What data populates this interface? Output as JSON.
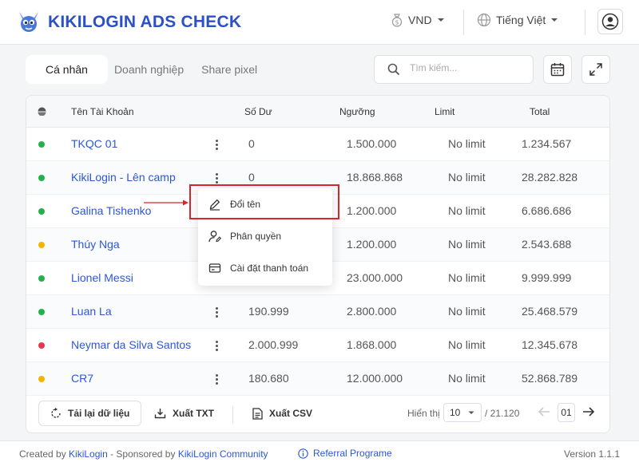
{
  "header": {
    "title": "KIKILOGIN ADS CHECK",
    "currency": "VND",
    "language": "Tiếng Việt"
  },
  "tabs": [
    {
      "label": "Cá nhân",
      "active": true
    },
    {
      "label": "Doanh nghiệp",
      "active": false
    },
    {
      "label": "Share pixel",
      "active": false
    }
  ],
  "search": {
    "placeholder": "Tìm kiếm...",
    "value": ""
  },
  "table": {
    "columns": [
      "Tên Tài Khoản",
      "Số Dư",
      "Ngưỡng",
      "Limit",
      "Total"
    ],
    "rows": [
      {
        "status": "#22b24c",
        "name": "TKQC 01",
        "balance": "0",
        "threshold": "1.500.000",
        "limit": "No limit",
        "total": "1.234.567"
      },
      {
        "status": "#22b24c",
        "name": "KikiLogin - Lên camp",
        "balance": "0",
        "threshold": "18.868.868",
        "limit": "No limit",
        "total": "28.282.828"
      },
      {
        "status": "#22b24c",
        "name": "Galina Tishenko",
        "balance": "",
        "threshold": "1.200.000",
        "limit": "No limit",
        "total": "6.686.686"
      },
      {
        "status": "#f5b400",
        "name": "Thúy Nga",
        "balance": "",
        "threshold": "1.200.000",
        "limit": "No limit",
        "total": "2.543.688"
      },
      {
        "status": "#22b24c",
        "name": "Lionel Messi",
        "balance": "",
        "threshold": "23.000.000",
        "limit": "No limit",
        "total": "9.999.999"
      },
      {
        "status": "#22b24c",
        "name": "Luan La",
        "balance": "190.999",
        "threshold": "2.800.000",
        "limit": "No limit",
        "total": "25.468.579"
      },
      {
        "status": "#e8384f",
        "name": "Neymar da Silva Santos",
        "balance": "2.000.999",
        "threshold": "1.868.000",
        "limit": "No limit",
        "total": "12.345.678"
      },
      {
        "status": "#f5b400",
        "name": "CR7",
        "balance": "180.680",
        "threshold": "12.000.000",
        "limit": "No limit",
        "total": "52.868.789"
      }
    ]
  },
  "context_menu": {
    "items": [
      {
        "label": "Đổi tên",
        "icon": "pencil-icon"
      },
      {
        "label": "Phân quyền",
        "icon": "user-permission-icon"
      },
      {
        "label": "Cài đặt thanh toán",
        "icon": "payment-card-icon"
      }
    ]
  },
  "toolbar": {
    "reload_label": "Tải lại dữ liệu",
    "export_txt_label": "Xuất TXT",
    "export_csv_label": "Xuất CSV"
  },
  "pagination": {
    "label": "Hiển thị",
    "page_size": "10",
    "total": "/ 21.120",
    "current_page": "01"
  },
  "footer": {
    "created_by_prefix": "Created by",
    "created_by_link": "KikiLogin",
    "sponsored_prefix": "- Sponsored by",
    "sponsored_link": "KikiLogin Community",
    "referral": "Referral Programe",
    "version": "Version 1.1.1"
  },
  "colors": {
    "brand": "#2b50c8",
    "link": "#2c57d8",
    "highlight": "#d8252b"
  }
}
